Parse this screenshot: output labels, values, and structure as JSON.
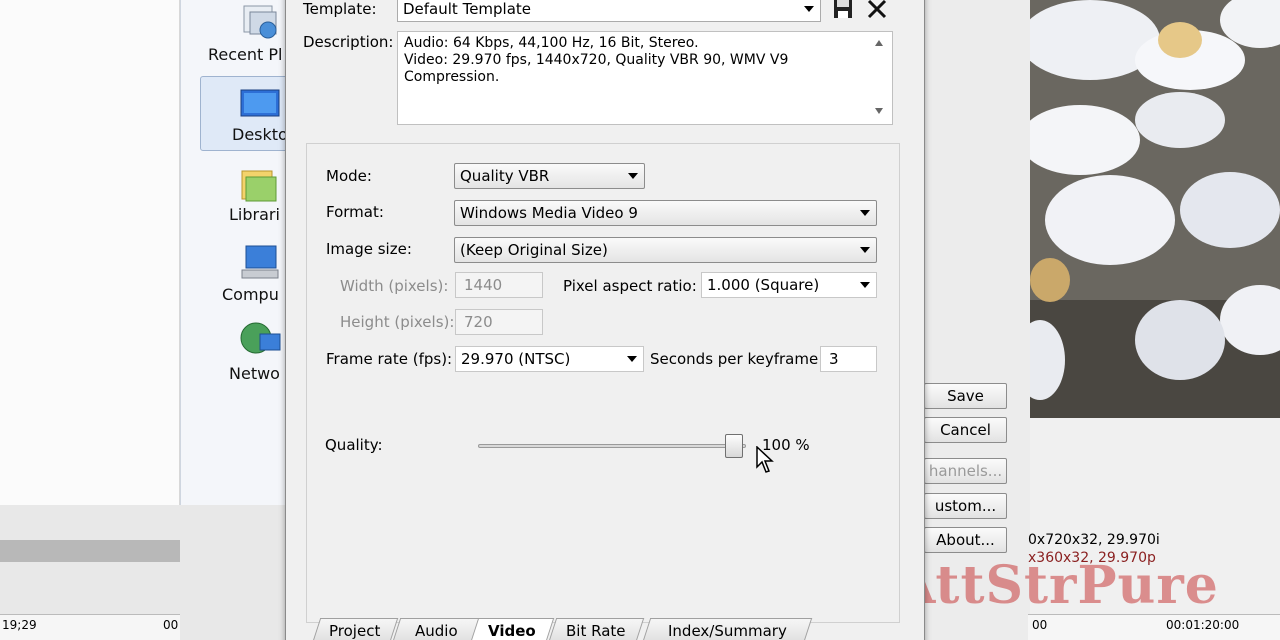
{
  "background": {
    "nav_items": [
      {
        "label": "Recent Pl",
        "icon": "recent-places-icon"
      },
      {
        "label": "Deskto",
        "icon": "desktop-icon"
      },
      {
        "label": "Librari",
        "icon": "libraries-icon"
      },
      {
        "label": "Compu",
        "icon": "computer-icon"
      },
      {
        "label": "Netwo",
        "icon": "network-icon"
      }
    ],
    "left_timecode": "19;29",
    "left_timecode_2": "00",
    "right_buttons": {
      "save": "Save",
      "cancel": "Cancel",
      "channels": "hannels...",
      "custom": "ustom...",
      "about": "About..."
    },
    "render_info": {
      "line1": "0x720x32, 29.970i",
      "line2": "x360x32, 29.970p"
    },
    "right_ruler": {
      "start": "00",
      "time": "00:01:20:00"
    },
    "watermark": "AttStrPure"
  },
  "dialog": {
    "template_label": "Template:",
    "template_value": "Default Template",
    "description_label": "Description:",
    "description_lines": [
      "Audio: 64 Kbps, 44,100 Hz, 16 Bit, Stereo.",
      "Video: 29.970 fps, 1440x720, Quality VBR 90, WMV V9",
      "Compression."
    ],
    "mode_label": "Mode:",
    "mode_value": "Quality VBR",
    "format_label": "Format:",
    "format_value": "Windows Media Video 9",
    "image_size_label": "Image size:",
    "image_size_value": "(Keep Original Size)",
    "width_label": "Width (pixels):",
    "width_value": "1440",
    "height_label": "Height (pixels):",
    "height_value": "720",
    "pixel_aspect_label": "Pixel aspect ratio:",
    "pixel_aspect_value": "1.000 (Square)",
    "frame_rate_label": "Frame rate (fps):",
    "frame_rate_value": "29.970 (NTSC)",
    "keyframe_label": "Seconds per keyframe:",
    "keyframe_value": "3",
    "quality_label": "Quality:",
    "quality_value_text": "100 %",
    "quality_fraction": 1.0,
    "tabs": [
      "Project",
      "Audio",
      "Video",
      "Bit Rate",
      "Index/Summary"
    ],
    "active_tab": "Video"
  }
}
